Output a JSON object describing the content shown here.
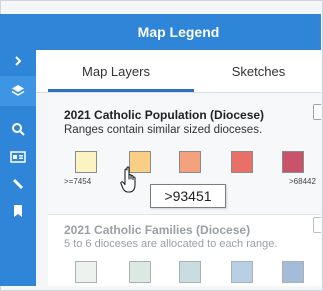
{
  "app": {
    "title": "Map Legend"
  },
  "tabs": [
    {
      "label": "Map Layers",
      "active": true
    },
    {
      "label": "Sketches",
      "active": false
    }
  ],
  "rail": {
    "icons": [
      "chevron-right-icon",
      "layers-icon",
      "zoom-icon",
      "map-card-icon",
      "ruler-icon",
      "bookmark-icon"
    ]
  },
  "layers": [
    {
      "title": "2021 Catholic Population (Diocese)",
      "description": "Ranges contain similar sized dioceses.",
      "checked": false,
      "swatches": [
        {
          "color": "#fbf3c2"
        },
        {
          "color": "#f9cf86"
        },
        {
          "color": "#f3a27d"
        },
        {
          "color": "#e97068"
        },
        {
          "color": "#c9536b"
        }
      ],
      "min_label": ">=7454",
      "max_label": ">68442",
      "tooltip": ">93451"
    },
    {
      "title": "2021 Catholic Families (Diocese)",
      "description": "5 to 6 dioceses are allocated to each range.",
      "checked": false,
      "swatches": [
        {
          "color": "#edf2ec"
        },
        {
          "color": "#dbe9e0"
        },
        {
          "color": "#c9dde0"
        },
        {
          "color": "#b9d0e4"
        },
        {
          "color": "#a3bcd8"
        }
      ]
    }
  ],
  "colors": {
    "accent": "#2f86d9",
    "tab_underline": "#2f6fb6"
  }
}
